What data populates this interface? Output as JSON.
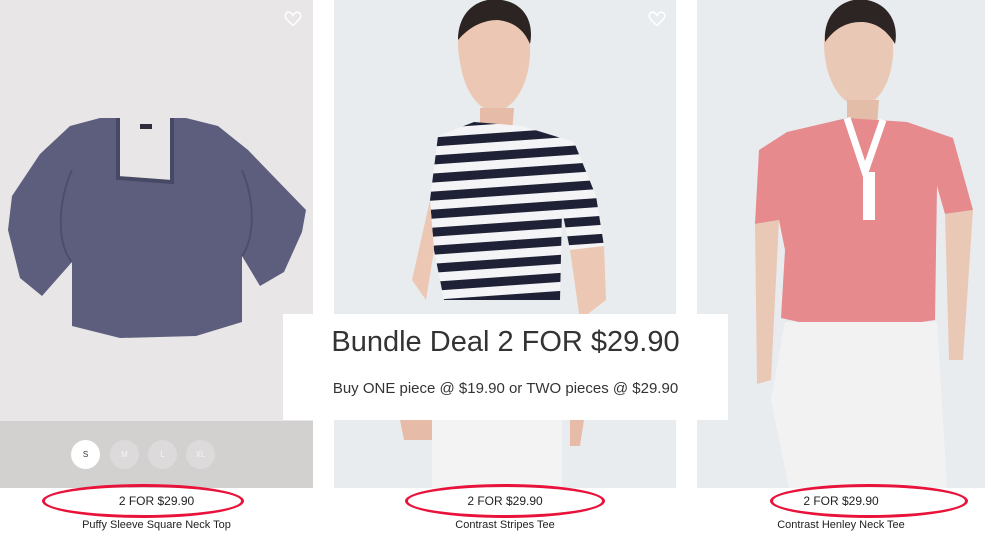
{
  "products": [
    {
      "price": "2 FOR $29.90",
      "name": "Puffy Sleeve Square Neck Top",
      "sizes": [
        "S",
        "M",
        "L",
        "XL"
      ],
      "selected_size": "S",
      "color": "#5d5e7e"
    },
    {
      "price": "2 FOR $29.90",
      "name": "Contrast Stripes Tee",
      "color": "#1f2236"
    },
    {
      "price": "2 FOR $29.90",
      "name": "Contrast Henley Neck Tee",
      "color": "#e68a8e"
    }
  ],
  "bundle": {
    "title": "Bundle Deal 2 FOR $29.90",
    "subtitle": "Buy ONE piece @ $19.90 or TWO pieces @ $29.90"
  },
  "highlight_color": "#e8123a"
}
